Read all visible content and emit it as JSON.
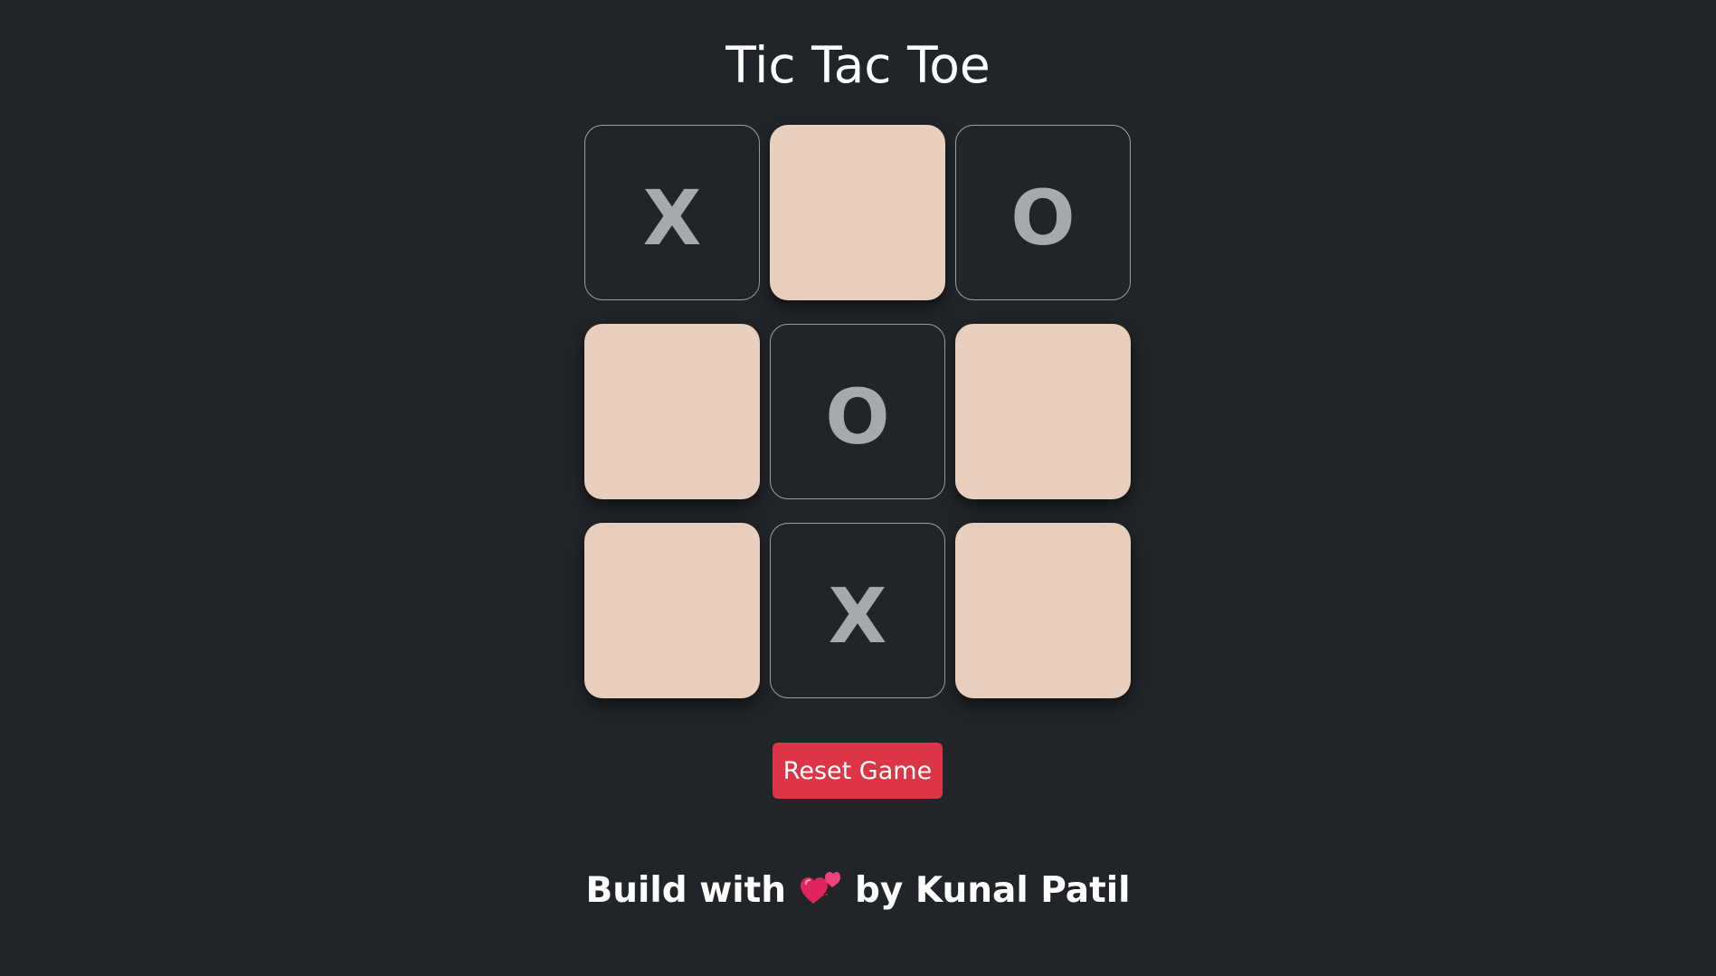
{
  "title": "Tic Tac Toe",
  "board": [
    "X",
    "",
    "O",
    "",
    "O",
    "",
    "",
    "X",
    ""
  ],
  "reset_label": "Reset Game",
  "footer": {
    "before": "Build with",
    "icon": "two-hearts-icon",
    "after": "by Kunal Patil"
  },
  "colors": {
    "background": "#212529",
    "empty_cell": "#e8cfbd",
    "mark": "#a7a9ab",
    "reset_button": "#dc3545"
  }
}
